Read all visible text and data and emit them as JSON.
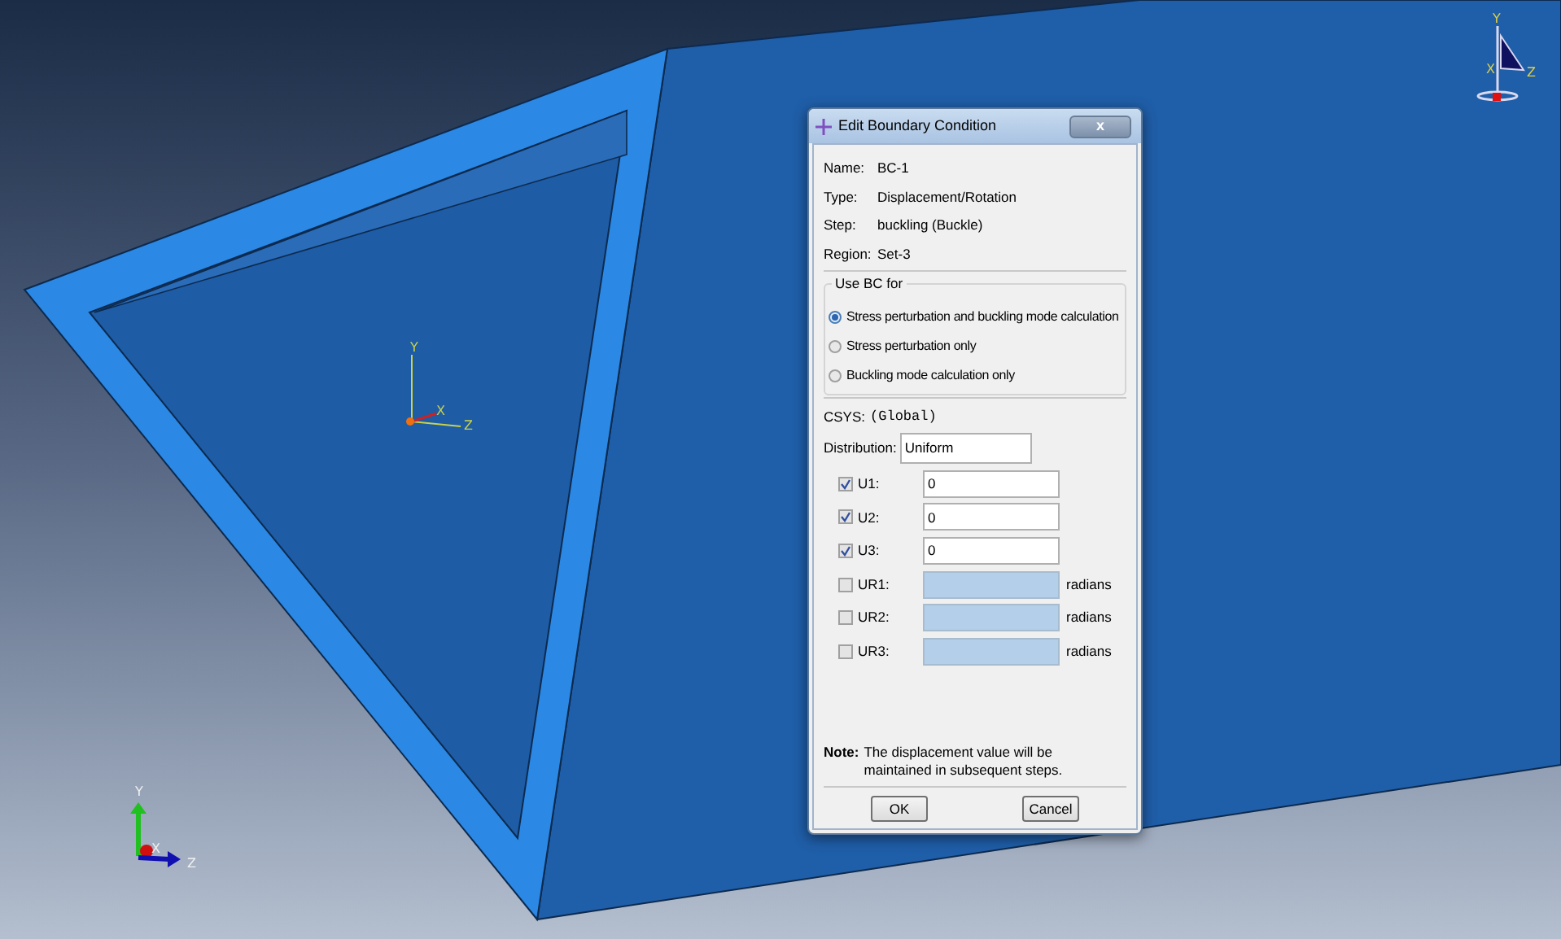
{
  "window": {
    "title": "Edit Boundary Condition",
    "close": "x"
  },
  "info": [
    {
      "label": "Name:",
      "value": "BC-1"
    },
    {
      "label": "Type:",
      "value": "Displacement/Rotation"
    },
    {
      "label": "Step:",
      "value": "buckling (Buckle)"
    },
    {
      "label": "Region:",
      "value": "Set-3"
    }
  ],
  "use_bc_for": {
    "title": "Use BC for",
    "options": [
      {
        "label": "Stress perturbation and buckling mode calculation",
        "selected": true
      },
      {
        "label": "Stress perturbation only",
        "selected": false
      },
      {
        "label": "Buckling mode calculation only",
        "selected": false
      }
    ]
  },
  "csys": {
    "label": "CSYS:",
    "value": "(Global)"
  },
  "distribution": {
    "label": "Distribution:",
    "value": "Uniform"
  },
  "components": [
    {
      "label": "U1:",
      "checked": true,
      "value": "0"
    },
    {
      "label": "U2:",
      "checked": true,
      "value": "0"
    },
    {
      "label": "U3:",
      "checked": true,
      "value": "0"
    },
    {
      "label": "UR1:",
      "checked": false,
      "unit": "radians"
    },
    {
      "label": "UR2:",
      "checked": false,
      "unit": "radians"
    },
    {
      "label": "UR3:",
      "checked": false,
      "unit": "radians"
    }
  ],
  "note": {
    "label": "Note:",
    "text": "The displacement value will be maintained in subsequent steps."
  },
  "buttons": [
    "OK",
    "Cancel"
  ],
  "triads": [
    {
      "kind": "model",
      "y": "Y",
      "x": "X",
      "z": "Z"
    },
    {
      "kind": "view",
      "y": "Y",
      "x": "X",
      "z": "Z"
    },
    {
      "kind": "global",
      "y": "Y",
      "x": "X",
      "z": "Z"
    }
  ]
}
